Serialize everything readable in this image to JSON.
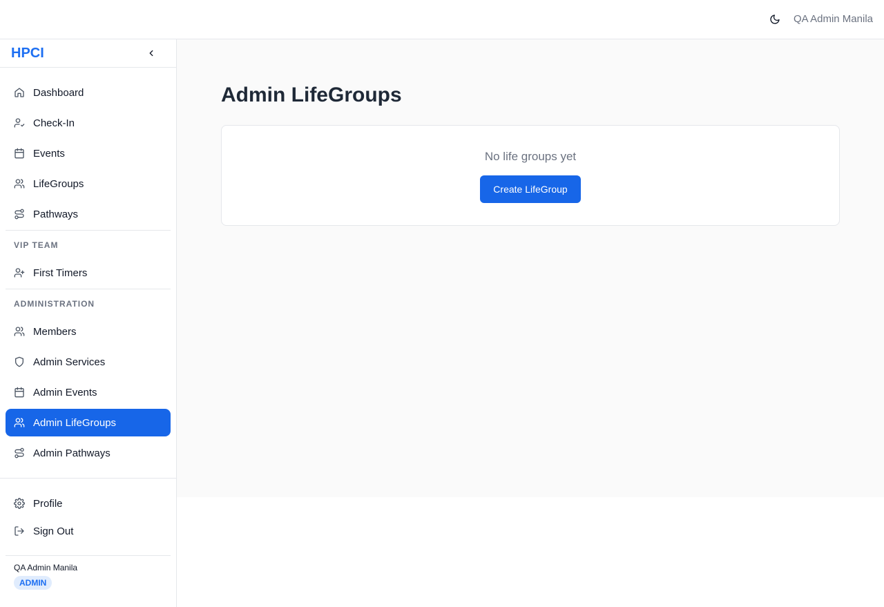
{
  "topbar": {
    "theme_icon": "moon-icon",
    "user_name": "QA Admin Manila"
  },
  "sidebar": {
    "brand": "HPCI",
    "collapse_icon": "chevron-left-icon",
    "main_items": [
      {
        "label": "Dashboard",
        "icon": "home-icon"
      },
      {
        "label": "Check-In",
        "icon": "user-check-icon"
      },
      {
        "label": "Events",
        "icon": "calendar-icon"
      },
      {
        "label": "LifeGroups",
        "icon": "users-icon"
      },
      {
        "label": "Pathways",
        "icon": "route-icon"
      }
    ],
    "vip_section": "VIP TEAM",
    "vip_items": [
      {
        "label": "First Timers",
        "icon": "user-plus-icon"
      }
    ],
    "admin_section": "ADMINISTRATION",
    "admin_items": [
      {
        "label": "Members",
        "icon": "users-icon"
      },
      {
        "label": "Admin Services",
        "icon": "shield-icon"
      },
      {
        "label": "Admin Events",
        "icon": "calendar-icon"
      },
      {
        "label": "Admin LifeGroups",
        "icon": "users-icon",
        "active": true
      },
      {
        "label": "Admin Pathways",
        "icon": "route-icon"
      }
    ],
    "bottom_items": [
      {
        "label": "Profile",
        "icon": "gear-icon"
      },
      {
        "label": "Sign Out",
        "icon": "sign-out-icon"
      }
    ],
    "footer_user": "QA Admin Manila",
    "footer_role": "ADMIN"
  },
  "main": {
    "title": "Admin LifeGroups",
    "empty_message": "No life groups yet",
    "create_button": "Create LifeGroup"
  },
  "colors": {
    "accent": "#1766e8",
    "brand": "#1d6ff2"
  }
}
